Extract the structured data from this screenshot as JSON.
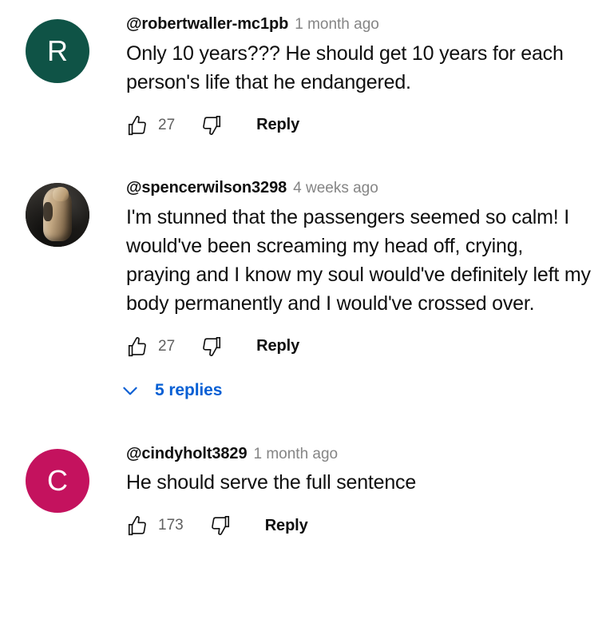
{
  "theme": {
    "text_primary": "#0f0f0f",
    "text_secondary": "#606060",
    "timestamp_color": "#858585",
    "link_blue": "#065fd4",
    "background": "#ffffff"
  },
  "comments": [
    {
      "avatar": {
        "type": "initial",
        "initial": "R",
        "color": "#0f5346"
      },
      "author": "@robertwaller-mc1pb",
      "timestamp": "1 month ago",
      "text": "Only 10 years??? He should get 10 years for each person's life that he endangered.",
      "like_count": "27",
      "reply_label": "Reply",
      "like_icon": "thumbs-up-icon",
      "dislike_icon": "thumbs-down-icon"
    },
    {
      "avatar": {
        "type": "photo",
        "initial": "",
        "color": "#2b2926"
      },
      "author": "@spencerwilson3298",
      "timestamp": "4 weeks ago",
      "text": "I'm stunned that the passengers seemed so calm! I would've been screaming my head off, crying, praying and I know my soul would've definitely left my body permanently and I would've crossed over.",
      "like_count": "27",
      "reply_label": "Reply",
      "like_icon": "thumbs-up-icon",
      "dislike_icon": "thumbs-down-icon",
      "replies": {
        "label": "5 replies",
        "expand_icon": "chevron-down-icon"
      }
    },
    {
      "avatar": {
        "type": "initial",
        "initial": "C",
        "color": "#c4125e"
      },
      "author": "@cindyholt3829",
      "timestamp": "1 month ago",
      "text": "He should serve the full sentence",
      "like_count": "173",
      "reply_label": "Reply",
      "like_icon": "thumbs-up-icon",
      "dislike_icon": "thumbs-down-icon"
    }
  ]
}
